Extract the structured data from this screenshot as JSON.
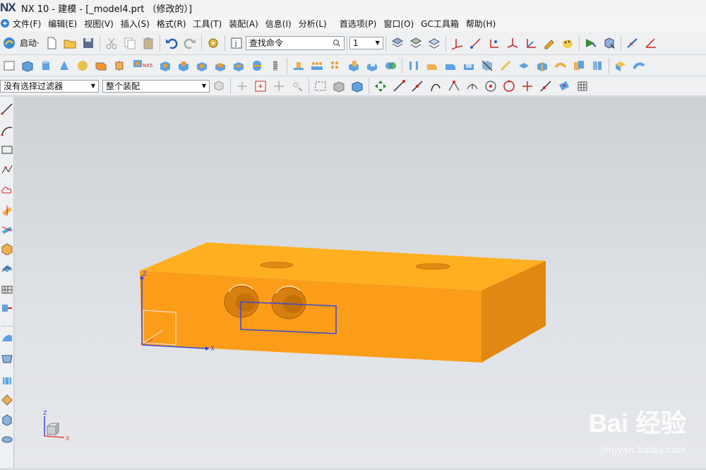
{
  "window": {
    "logo": "NX",
    "title": "NX 10 - 建模 - [_model4.prt （修改的）]"
  },
  "menu": [
    "文件(F)",
    "编辑(E)",
    "视图(V)",
    "插入(S)",
    "格式(R)",
    "工具(T)",
    "装配(A)",
    "信息(I)",
    "分析(L)",
    "首选项(P)",
    "窗口(O)",
    "GC工具箱",
    "帮助(H)"
  ],
  "toolbar": {
    "start_label": "启动·",
    "search_placeholder": "查找命令",
    "layer_value": "1",
    "nx5_label": "NX5"
  },
  "selection": {
    "filter_value": "没有选择过滤器",
    "scope_value": "整个装配"
  },
  "viewport": {
    "csys_origin_labels": {
      "z": "Z",
      "x": "X"
    },
    "triad_labels": {
      "z": "Z",
      "x": "X"
    },
    "body_color": "#ffa500",
    "watermark": "Bai 经验",
    "watermark_url": "jingyan.baidu.com"
  }
}
